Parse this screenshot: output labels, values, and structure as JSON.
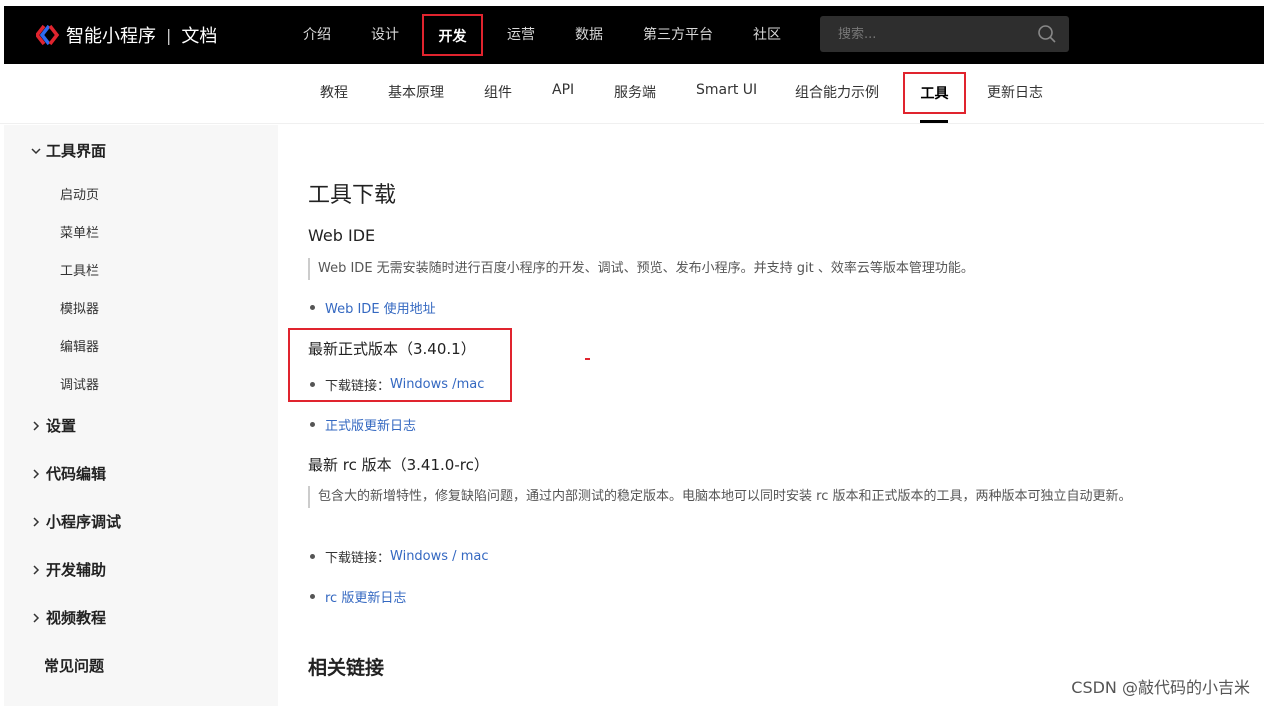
{
  "header": {
    "logo_text": "智能小程序",
    "logo_sep": "|",
    "logo_sub": "文档",
    "nav": [
      "介绍",
      "设计",
      "开发",
      "运营",
      "数据",
      "第三方平台",
      "社区"
    ],
    "search_placeholder": "搜索..."
  },
  "subnav": {
    "items": [
      "教程",
      "基本原理",
      "组件",
      "API",
      "服务端",
      "Smart UI",
      "组合能力示例",
      "工具",
      "更新日志"
    ]
  },
  "sidebar": {
    "group1": "工具界面",
    "items": [
      "启动页",
      "菜单栏",
      "工具栏",
      "模拟器",
      "编辑器",
      "调试器"
    ],
    "groups": [
      "设置",
      "代码编辑",
      "小程序调试",
      "开发辅助",
      "视频教程",
      "常见问题"
    ]
  },
  "content": {
    "title": "工具下载",
    "webide": {
      "heading": "Web IDE",
      "desc": "Web IDE 无需安装随时进行百度小程序的开发、调试、预览、发布小程序。并支持 git 、效率云等版本管理功能。",
      "link": "Web IDE 使用地址"
    },
    "stable": {
      "heading": "最新正式版本（3.40.1）",
      "download_label": "下载链接：",
      "windows": "Windows",
      "sep": " /",
      "mac": "mac",
      "changelog": "正式版更新日志"
    },
    "rc": {
      "heading": "最新 rc 版本（3.41.0-rc）",
      "desc": "包含大的新增特性，修复缺陷问题，通过内部测试的稳定版本。电脑本地可以同时安装 rc 版本和正式版本的工具，两种版本可独立自动更新。",
      "download_label": "下载链接：",
      "windows": "Windows",
      "sep": " / ",
      "mac": "mac",
      "changelog": "rc 版更新日志"
    },
    "related_title": "相关链接"
  },
  "watermark": "CSDN @敲代码的小吉米"
}
